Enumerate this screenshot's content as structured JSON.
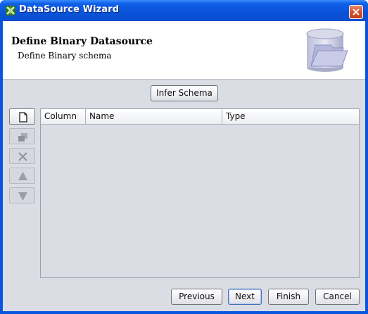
{
  "window": {
    "title": "DataSource Wizard"
  },
  "header": {
    "title": "Define Binary Datasource",
    "subtitle": "Define Binary schema"
  },
  "toolbar": {
    "infer_schema_label": "Infer Schema"
  },
  "side_buttons": [
    {
      "icon": "new-document-icon",
      "enabled": true
    },
    {
      "icon": "copy-icon",
      "enabled": false
    },
    {
      "icon": "delete-x-icon",
      "enabled": false
    },
    {
      "icon": "arrow-up-icon",
      "enabled": false
    },
    {
      "icon": "arrow-down-icon",
      "enabled": false
    }
  ],
  "table": {
    "columns": [
      "Column",
      "Name",
      "Type"
    ],
    "rows": []
  },
  "navigation": {
    "previous_label": "Previous",
    "next_label": "Next",
    "finish_label": "Finish",
    "cancel_label": "Cancel"
  },
  "colors": {
    "titlebar": "#0a53d8",
    "client_background": "#dadde4",
    "close_button": "#d8552c"
  }
}
